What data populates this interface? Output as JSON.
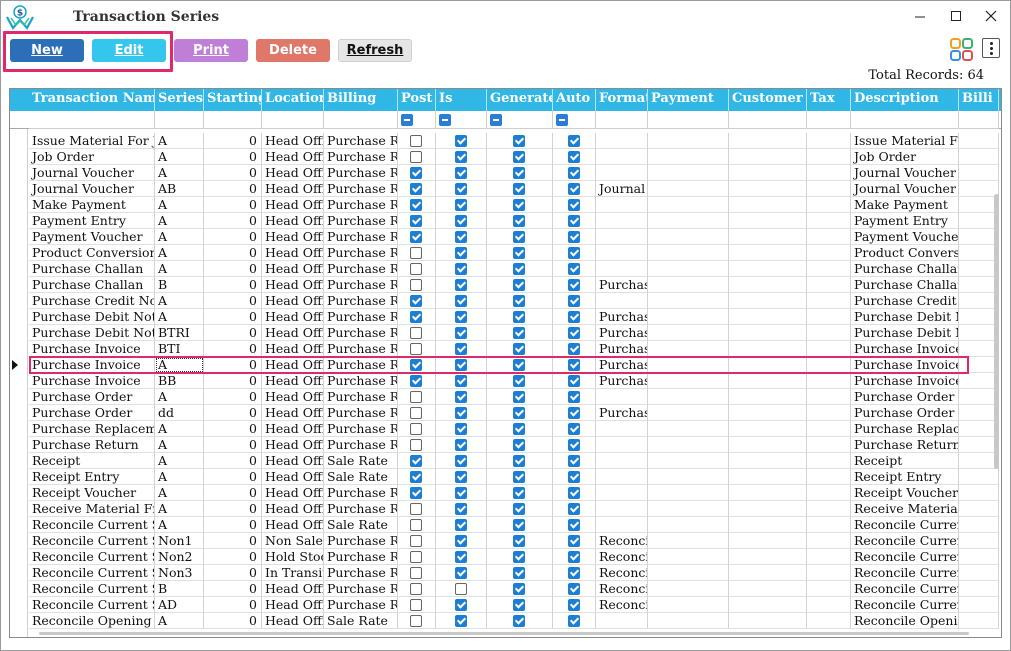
{
  "window": {
    "title": "Transaction Series"
  },
  "colors": {
    "accent": "#31b7e6",
    "new": "#2c6eb8",
    "edit": "#35c6ee",
    "print": "#c07fd6",
    "delete": "#e0786a",
    "highlight": "#e0286d",
    "check": "#1d7fd1"
  },
  "toolbar": {
    "new_label": "New",
    "edit_label": "Edit",
    "print_label": "Print",
    "delete_label": "Delete",
    "refresh_label": "Refresh"
  },
  "total_records": "Total Records: 64",
  "columns": [
    {
      "key": "name",
      "label": "Transaction Name",
      "type": "text"
    },
    {
      "key": "series",
      "label": "Series",
      "type": "text"
    },
    {
      "key": "start",
      "label": "Starting",
      "type": "num"
    },
    {
      "key": "loc",
      "label": "Location",
      "type": "text"
    },
    {
      "key": "billing",
      "label": "Billing",
      "type": "text"
    },
    {
      "key": "post",
      "label": "Post",
      "type": "check"
    },
    {
      "key": "is",
      "label": "Is",
      "type": "check"
    },
    {
      "key": "gen",
      "label": "Generate",
      "type": "check"
    },
    {
      "key": "auto",
      "label": "Auto",
      "type": "check"
    },
    {
      "key": "format",
      "label": "Format",
      "type": "text"
    },
    {
      "key": "payment",
      "label": "Payment",
      "type": "text"
    },
    {
      "key": "customer",
      "label": "Customer",
      "type": "text"
    },
    {
      "key": "tax",
      "label": "Tax",
      "type": "text"
    },
    {
      "key": "desc",
      "label": "Description",
      "type": "text"
    },
    {
      "key": "bill2",
      "label": "Billi",
      "type": "text"
    }
  ],
  "selected_row": 14,
  "rows": [
    {
      "name": "Issue Material For Jo",
      "series": "A",
      "start": "0",
      "loc": "Head Offi",
      "billing": "Purchase Ra",
      "post": false,
      "is": true,
      "gen": true,
      "auto": true,
      "format": "",
      "desc": "Issue Material Fo"
    },
    {
      "name": "Job Order",
      "series": "A",
      "start": "0",
      "loc": "Head Offi",
      "billing": "Purchase Ra",
      "post": false,
      "is": true,
      "gen": true,
      "auto": true,
      "format": "",
      "desc": "Job Order"
    },
    {
      "name": "Journal Voucher",
      "series": "A",
      "start": "0",
      "loc": "Head Offi",
      "billing": "Purchase Ra",
      "post": true,
      "is": true,
      "gen": true,
      "auto": true,
      "format": "",
      "desc": "Journal Voucher"
    },
    {
      "name": "Journal Voucher",
      "series": "AB",
      "start": "0",
      "loc": "Head Offi",
      "billing": "Purchase Ra",
      "post": true,
      "is": true,
      "gen": true,
      "auto": true,
      "format": "Journal",
      "desc": "Journal Voucher"
    },
    {
      "name": "Make Payment",
      "series": "A",
      "start": "0",
      "loc": "Head Offi",
      "billing": "Purchase Ra",
      "post": true,
      "is": true,
      "gen": true,
      "auto": true,
      "format": "",
      "desc": "Make Payment"
    },
    {
      "name": "Payment Entry",
      "series": "A",
      "start": "0",
      "loc": "Head Offi",
      "billing": "Purchase Ra",
      "post": true,
      "is": true,
      "gen": true,
      "auto": true,
      "format": "",
      "desc": "Payment Entry"
    },
    {
      "name": "Payment Voucher",
      "series": "A",
      "start": "0",
      "loc": "Head Offi",
      "billing": "Purchase Ra",
      "post": true,
      "is": true,
      "gen": true,
      "auto": true,
      "format": "",
      "desc": "Payment Voucher"
    },
    {
      "name": "Product Conversion",
      "series": "A",
      "start": "0",
      "loc": "Head Offi",
      "billing": "Purchase Ra",
      "post": false,
      "is": true,
      "gen": true,
      "auto": true,
      "format": "",
      "desc": "Product Conversi"
    },
    {
      "name": "Purchase Challan",
      "series": "A",
      "start": "0",
      "loc": "Head Offi",
      "billing": "Purchase Ra",
      "post": false,
      "is": true,
      "gen": true,
      "auto": true,
      "format": "",
      "desc": "Purchase Challan"
    },
    {
      "name": "Purchase Challan",
      "series": "B",
      "start": "0",
      "loc": "Head Offi",
      "billing": "Purchase Ra",
      "post": false,
      "is": true,
      "gen": true,
      "auto": true,
      "format": "Purchas",
      "desc": "Purchase Challan"
    },
    {
      "name": "Purchase Credit Note",
      "series": "A",
      "start": "0",
      "loc": "Head Offi",
      "billing": "Purchase Ra",
      "post": true,
      "is": true,
      "gen": true,
      "auto": true,
      "format": "",
      "desc": "Purchase Credit N"
    },
    {
      "name": "Purchase Debit Note",
      "series": "A",
      "start": "0",
      "loc": "Head Offi",
      "billing": "Purchase Ra",
      "post": true,
      "is": true,
      "gen": true,
      "auto": true,
      "format": "Purchas",
      "desc": "Purchase Debit N"
    },
    {
      "name": "Purchase Debit Note",
      "series": "BTRI",
      "start": "0",
      "loc": "Head Offi",
      "billing": "Purchase Ra",
      "post": false,
      "is": true,
      "gen": true,
      "auto": true,
      "format": "Purchas",
      "desc": "Purchase Debit N"
    },
    {
      "name": "Purchase Invoice",
      "series": "BTI",
      "start": "0",
      "loc": "Head Offi",
      "billing": "Purchase Ra",
      "post": false,
      "is": true,
      "gen": true,
      "auto": true,
      "format": "Purchas",
      "desc": "Purchase Invoice"
    },
    {
      "name": "Purchase Invoice",
      "series": "A",
      "start": "0",
      "loc": "Head Offi",
      "billing": "Purchase Ra",
      "post": true,
      "is": true,
      "gen": true,
      "auto": true,
      "format": "Purchas",
      "desc": "Purchase Invoice"
    },
    {
      "name": "Purchase Invoice",
      "series": "BB",
      "start": "0",
      "loc": "Head Offi",
      "billing": "Purchase Ra",
      "post": true,
      "is": true,
      "gen": true,
      "auto": true,
      "format": "Purchas",
      "desc": "Purchase Invoice"
    },
    {
      "name": "Purchase Order",
      "series": "A",
      "start": "0",
      "loc": "Head Offi",
      "billing": "Purchase Ra",
      "post": false,
      "is": true,
      "gen": true,
      "auto": true,
      "format": "",
      "desc": "Purchase Order"
    },
    {
      "name": "Purchase Order",
      "series": "dd",
      "start": "0",
      "loc": "Head Offi",
      "billing": "Purchase Ra",
      "post": false,
      "is": true,
      "gen": true,
      "auto": true,
      "format": "Purchas",
      "desc": "Purchase Order"
    },
    {
      "name": "Purchase Replaceme",
      "series": "A",
      "start": "0",
      "loc": "Head Offi",
      "billing": "Purchase Ra",
      "post": false,
      "is": true,
      "gen": true,
      "auto": true,
      "format": "",
      "desc": "Purchase Replace"
    },
    {
      "name": "Purchase Return",
      "series": "A",
      "start": "0",
      "loc": "Head Offi",
      "billing": "Purchase Ra",
      "post": false,
      "is": true,
      "gen": true,
      "auto": true,
      "format": "",
      "desc": "Purchase Return"
    },
    {
      "name": "Receipt",
      "series": "A",
      "start": "0",
      "loc": "Head Offi",
      "billing": "Sale Rate",
      "post": true,
      "is": true,
      "gen": true,
      "auto": true,
      "format": "",
      "desc": "Receipt"
    },
    {
      "name": "Receipt Entry",
      "series": "A",
      "start": "0",
      "loc": "Head Offi",
      "billing": "Sale Rate",
      "post": true,
      "is": true,
      "gen": true,
      "auto": true,
      "format": "",
      "desc": "Receipt Entry"
    },
    {
      "name": "Receipt Voucher",
      "series": "A",
      "start": "0",
      "loc": "Head Offi",
      "billing": "Purchase Ra",
      "post": true,
      "is": true,
      "gen": true,
      "auto": true,
      "format": "",
      "desc": "Receipt Voucher"
    },
    {
      "name": "Receive Material Fro",
      "series": "A",
      "start": "0",
      "loc": "Head Offi",
      "billing": "Purchase Ra",
      "post": false,
      "is": true,
      "gen": true,
      "auto": true,
      "format": "",
      "desc": "Receive Material"
    },
    {
      "name": "Reconcile Current St",
      "series": "A",
      "start": "0",
      "loc": "Head Offi",
      "billing": "Sale Rate",
      "post": false,
      "is": true,
      "gen": true,
      "auto": true,
      "format": "",
      "desc": "Reconcile Curren"
    },
    {
      "name": "Reconcile Current St",
      "series": "Non1",
      "start": "0",
      "loc": "Non Salea",
      "billing": "Purchase Ra",
      "post": false,
      "is": true,
      "gen": true,
      "auto": true,
      "format": "Reconci",
      "desc": "Reconcile Curren"
    },
    {
      "name": "Reconcile Current St",
      "series": "Non2",
      "start": "0",
      "loc": "Hold Stoc",
      "billing": "Purchase Ra",
      "post": false,
      "is": true,
      "gen": true,
      "auto": true,
      "format": "Reconci",
      "desc": "Reconcile Curren"
    },
    {
      "name": "Reconcile Current St",
      "series": "Non3",
      "start": "0",
      "loc": "In Transit",
      "billing": "Purchase Ra",
      "post": false,
      "is": true,
      "gen": true,
      "auto": true,
      "format": "Reconci",
      "desc": "Reconcile Curren"
    },
    {
      "name": "Reconcile Current St",
      "series": "B",
      "start": "0",
      "loc": "Head Offi",
      "billing": "Purchase Ra",
      "post": false,
      "is": false,
      "gen": true,
      "auto": true,
      "format": "Reconci",
      "desc": "Reconcile Curren"
    },
    {
      "name": "Reconcile Current St",
      "series": "AD",
      "start": "0",
      "loc": "Head Offi",
      "billing": "Purchase Ra",
      "post": false,
      "is": true,
      "gen": true,
      "auto": true,
      "format": "Reconci",
      "desc": "Reconcile Curren"
    },
    {
      "name": "Reconcile Opening S",
      "series": "A",
      "start": "0",
      "loc": "Head Offi",
      "billing": "Sale Rate",
      "post": false,
      "is": true,
      "gen": true,
      "auto": true,
      "format": "",
      "desc": "Reconcile Openin"
    }
  ]
}
